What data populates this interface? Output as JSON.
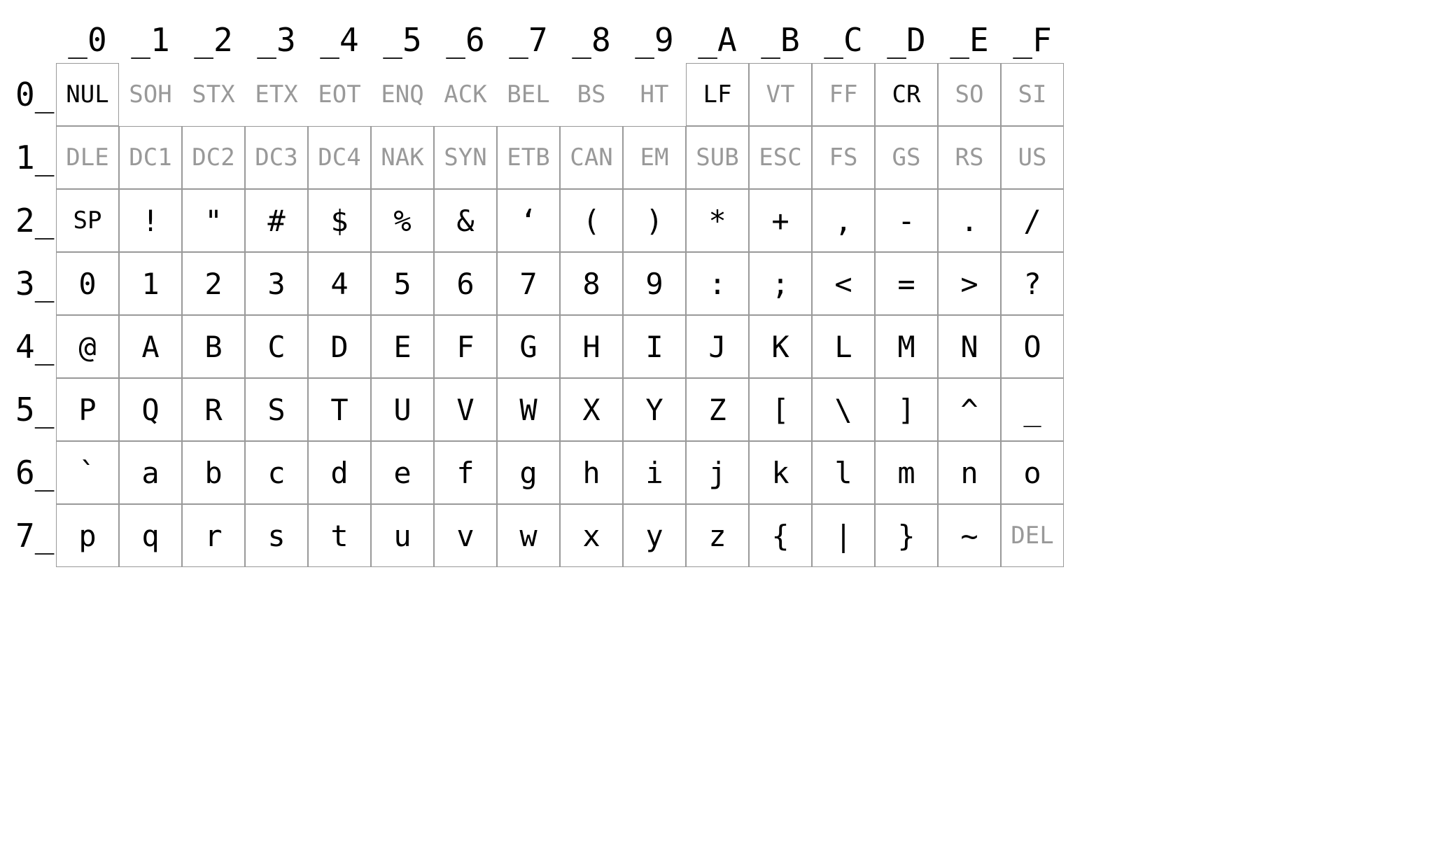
{
  "columns": [
    "_0",
    "_1",
    "_2",
    "_3",
    "_4",
    "_5",
    "_6",
    "_7",
    "_8",
    "_9",
    "_A",
    "_B",
    "_C",
    "_D",
    "_E",
    "_F"
  ],
  "rows": [
    "0_",
    "1_",
    "2_",
    "3_",
    "4_",
    "5_",
    "6_",
    "7_"
  ],
  "cells": [
    [
      {
        "t": "NUL",
        "ctrl": true,
        "emph": true,
        "bord": true
      },
      {
        "t": "SOH",
        "ctrl": true,
        "emph": false,
        "bord": false
      },
      {
        "t": "STX",
        "ctrl": true,
        "emph": false,
        "bord": false
      },
      {
        "t": "ETX",
        "ctrl": true,
        "emph": false,
        "bord": false
      },
      {
        "t": "EOT",
        "ctrl": true,
        "emph": false,
        "bord": false
      },
      {
        "t": "ENQ",
        "ctrl": true,
        "emph": false,
        "bord": false
      },
      {
        "t": "ACK",
        "ctrl": true,
        "emph": false,
        "bord": false
      },
      {
        "t": "BEL",
        "ctrl": true,
        "emph": false,
        "bord": false
      },
      {
        "t": "BS",
        "ctrl": true,
        "emph": false,
        "bord": false
      },
      {
        "t": "HT",
        "ctrl": true,
        "emph": false,
        "bord": false
      },
      {
        "t": "LF",
        "ctrl": true,
        "emph": true,
        "bord": true
      },
      {
        "t": "VT",
        "ctrl": true,
        "emph": false,
        "bord": true
      },
      {
        "t": "FF",
        "ctrl": true,
        "emph": false,
        "bord": true
      },
      {
        "t": "CR",
        "ctrl": true,
        "emph": true,
        "bord": true
      },
      {
        "t": "SO",
        "ctrl": true,
        "emph": false,
        "bord": true
      },
      {
        "t": "SI",
        "ctrl": true,
        "emph": false,
        "bord": true
      }
    ],
    [
      {
        "t": "DLE",
        "ctrl": true,
        "emph": false,
        "bord": true
      },
      {
        "t": "DC1",
        "ctrl": true,
        "emph": false,
        "bord": true
      },
      {
        "t": "DC2",
        "ctrl": true,
        "emph": false,
        "bord": true
      },
      {
        "t": "DC3",
        "ctrl": true,
        "emph": false,
        "bord": true
      },
      {
        "t": "DC4",
        "ctrl": true,
        "emph": false,
        "bord": true
      },
      {
        "t": "NAK",
        "ctrl": true,
        "emph": false,
        "bord": true
      },
      {
        "t": "SYN",
        "ctrl": true,
        "emph": false,
        "bord": true
      },
      {
        "t": "ETB",
        "ctrl": true,
        "emph": false,
        "bord": true
      },
      {
        "t": "CAN",
        "ctrl": true,
        "emph": false,
        "bord": true
      },
      {
        "t": "EM",
        "ctrl": true,
        "emph": false,
        "bord": true
      },
      {
        "t": "SUB",
        "ctrl": true,
        "emph": false,
        "bord": true
      },
      {
        "t": "ESC",
        "ctrl": true,
        "emph": false,
        "bord": true
      },
      {
        "t": "FS",
        "ctrl": true,
        "emph": false,
        "bord": true
      },
      {
        "t": "GS",
        "ctrl": true,
        "emph": false,
        "bord": true
      },
      {
        "t": "RS",
        "ctrl": true,
        "emph": false,
        "bord": true
      },
      {
        "t": "US",
        "ctrl": true,
        "emph": false,
        "bord": true
      }
    ],
    [
      {
        "t": "SP",
        "ctrl": false,
        "emph": false,
        "bord": true,
        "small": true
      },
      {
        "t": "!",
        "ctrl": false,
        "emph": false,
        "bord": true
      },
      {
        "t": "\"",
        "ctrl": false,
        "emph": false,
        "bord": true
      },
      {
        "t": "#",
        "ctrl": false,
        "emph": false,
        "bord": true
      },
      {
        "t": "$",
        "ctrl": false,
        "emph": false,
        "bord": true
      },
      {
        "t": "%",
        "ctrl": false,
        "emph": false,
        "bord": true
      },
      {
        "t": "&",
        "ctrl": false,
        "emph": false,
        "bord": true
      },
      {
        "t": "‘",
        "ctrl": false,
        "emph": false,
        "bord": true
      },
      {
        "t": "(",
        "ctrl": false,
        "emph": false,
        "bord": true
      },
      {
        "t": ")",
        "ctrl": false,
        "emph": false,
        "bord": true
      },
      {
        "t": "*",
        "ctrl": false,
        "emph": false,
        "bord": true
      },
      {
        "t": "+",
        "ctrl": false,
        "emph": false,
        "bord": true
      },
      {
        "t": ",",
        "ctrl": false,
        "emph": false,
        "bord": true
      },
      {
        "t": "-",
        "ctrl": false,
        "emph": false,
        "bord": true
      },
      {
        "t": ".",
        "ctrl": false,
        "emph": false,
        "bord": true
      },
      {
        "t": "/",
        "ctrl": false,
        "emph": false,
        "bord": true
      }
    ],
    [
      {
        "t": "0",
        "ctrl": false,
        "emph": false,
        "bord": true
      },
      {
        "t": "1",
        "ctrl": false,
        "emph": false,
        "bord": true
      },
      {
        "t": "2",
        "ctrl": false,
        "emph": false,
        "bord": true
      },
      {
        "t": "3",
        "ctrl": false,
        "emph": false,
        "bord": true
      },
      {
        "t": "4",
        "ctrl": false,
        "emph": false,
        "bord": true
      },
      {
        "t": "5",
        "ctrl": false,
        "emph": false,
        "bord": true
      },
      {
        "t": "6",
        "ctrl": false,
        "emph": false,
        "bord": true
      },
      {
        "t": "7",
        "ctrl": false,
        "emph": false,
        "bord": true
      },
      {
        "t": "8",
        "ctrl": false,
        "emph": false,
        "bord": true
      },
      {
        "t": "9",
        "ctrl": false,
        "emph": false,
        "bord": true
      },
      {
        "t": ":",
        "ctrl": false,
        "emph": false,
        "bord": true
      },
      {
        "t": ";",
        "ctrl": false,
        "emph": false,
        "bord": true
      },
      {
        "t": "<",
        "ctrl": false,
        "emph": false,
        "bord": true
      },
      {
        "t": "=",
        "ctrl": false,
        "emph": false,
        "bord": true
      },
      {
        "t": ">",
        "ctrl": false,
        "emph": false,
        "bord": true
      },
      {
        "t": "?",
        "ctrl": false,
        "emph": false,
        "bord": true
      }
    ],
    [
      {
        "t": "@",
        "ctrl": false,
        "emph": false,
        "bord": true
      },
      {
        "t": "A",
        "ctrl": false,
        "emph": false,
        "bord": true
      },
      {
        "t": "B",
        "ctrl": false,
        "emph": false,
        "bord": true
      },
      {
        "t": "C",
        "ctrl": false,
        "emph": false,
        "bord": true
      },
      {
        "t": "D",
        "ctrl": false,
        "emph": false,
        "bord": true
      },
      {
        "t": "E",
        "ctrl": false,
        "emph": false,
        "bord": true
      },
      {
        "t": "F",
        "ctrl": false,
        "emph": false,
        "bord": true
      },
      {
        "t": "G",
        "ctrl": false,
        "emph": false,
        "bord": true
      },
      {
        "t": "H",
        "ctrl": false,
        "emph": false,
        "bord": true
      },
      {
        "t": "I",
        "ctrl": false,
        "emph": false,
        "bord": true
      },
      {
        "t": "J",
        "ctrl": false,
        "emph": false,
        "bord": true
      },
      {
        "t": "K",
        "ctrl": false,
        "emph": false,
        "bord": true
      },
      {
        "t": "L",
        "ctrl": false,
        "emph": false,
        "bord": true
      },
      {
        "t": "M",
        "ctrl": false,
        "emph": false,
        "bord": true
      },
      {
        "t": "N",
        "ctrl": false,
        "emph": false,
        "bord": true
      },
      {
        "t": "O",
        "ctrl": false,
        "emph": false,
        "bord": true
      }
    ],
    [
      {
        "t": "P",
        "ctrl": false,
        "emph": false,
        "bord": true
      },
      {
        "t": "Q",
        "ctrl": false,
        "emph": false,
        "bord": true
      },
      {
        "t": "R",
        "ctrl": false,
        "emph": false,
        "bord": true
      },
      {
        "t": "S",
        "ctrl": false,
        "emph": false,
        "bord": true
      },
      {
        "t": "T",
        "ctrl": false,
        "emph": false,
        "bord": true
      },
      {
        "t": "U",
        "ctrl": false,
        "emph": false,
        "bord": true
      },
      {
        "t": "V",
        "ctrl": false,
        "emph": false,
        "bord": true
      },
      {
        "t": "W",
        "ctrl": false,
        "emph": false,
        "bord": true
      },
      {
        "t": "X",
        "ctrl": false,
        "emph": false,
        "bord": true
      },
      {
        "t": "Y",
        "ctrl": false,
        "emph": false,
        "bord": true
      },
      {
        "t": "Z",
        "ctrl": false,
        "emph": false,
        "bord": true
      },
      {
        "t": "[",
        "ctrl": false,
        "emph": false,
        "bord": true
      },
      {
        "t": "\\",
        "ctrl": false,
        "emph": false,
        "bord": true
      },
      {
        "t": "]",
        "ctrl": false,
        "emph": false,
        "bord": true
      },
      {
        "t": "^",
        "ctrl": false,
        "emph": false,
        "bord": true
      },
      {
        "t": "_",
        "ctrl": false,
        "emph": false,
        "bord": true
      }
    ],
    [
      {
        "t": "`",
        "ctrl": false,
        "emph": false,
        "bord": true
      },
      {
        "t": "a",
        "ctrl": false,
        "emph": false,
        "bord": true
      },
      {
        "t": "b",
        "ctrl": false,
        "emph": false,
        "bord": true
      },
      {
        "t": "c",
        "ctrl": false,
        "emph": false,
        "bord": true
      },
      {
        "t": "d",
        "ctrl": false,
        "emph": false,
        "bord": true
      },
      {
        "t": "e",
        "ctrl": false,
        "emph": false,
        "bord": true
      },
      {
        "t": "f",
        "ctrl": false,
        "emph": false,
        "bord": true
      },
      {
        "t": "g",
        "ctrl": false,
        "emph": false,
        "bord": true
      },
      {
        "t": "h",
        "ctrl": false,
        "emph": false,
        "bord": true
      },
      {
        "t": "i",
        "ctrl": false,
        "emph": false,
        "bord": true
      },
      {
        "t": "j",
        "ctrl": false,
        "emph": false,
        "bord": true
      },
      {
        "t": "k",
        "ctrl": false,
        "emph": false,
        "bord": true
      },
      {
        "t": "l",
        "ctrl": false,
        "emph": false,
        "bord": true
      },
      {
        "t": "m",
        "ctrl": false,
        "emph": false,
        "bord": true
      },
      {
        "t": "n",
        "ctrl": false,
        "emph": false,
        "bord": true
      },
      {
        "t": "o",
        "ctrl": false,
        "emph": false,
        "bord": true
      }
    ],
    [
      {
        "t": "p",
        "ctrl": false,
        "emph": false,
        "bord": true
      },
      {
        "t": "q",
        "ctrl": false,
        "emph": false,
        "bord": true
      },
      {
        "t": "r",
        "ctrl": false,
        "emph": false,
        "bord": true
      },
      {
        "t": "s",
        "ctrl": false,
        "emph": false,
        "bord": true
      },
      {
        "t": "t",
        "ctrl": false,
        "emph": false,
        "bord": true
      },
      {
        "t": "u",
        "ctrl": false,
        "emph": false,
        "bord": true
      },
      {
        "t": "v",
        "ctrl": false,
        "emph": false,
        "bord": true
      },
      {
        "t": "w",
        "ctrl": false,
        "emph": false,
        "bord": true
      },
      {
        "t": "x",
        "ctrl": false,
        "emph": false,
        "bord": true
      },
      {
        "t": "y",
        "ctrl": false,
        "emph": false,
        "bord": true
      },
      {
        "t": "z",
        "ctrl": false,
        "emph": false,
        "bord": true
      },
      {
        "t": "{",
        "ctrl": false,
        "emph": false,
        "bord": true
      },
      {
        "t": "|",
        "ctrl": false,
        "emph": false,
        "bord": true
      },
      {
        "t": "}",
        "ctrl": false,
        "emph": false,
        "bord": true
      },
      {
        "t": "~",
        "ctrl": false,
        "emph": false,
        "bord": true
      },
      {
        "t": "DEL",
        "ctrl": true,
        "emph": false,
        "bord": true
      }
    ]
  ]
}
